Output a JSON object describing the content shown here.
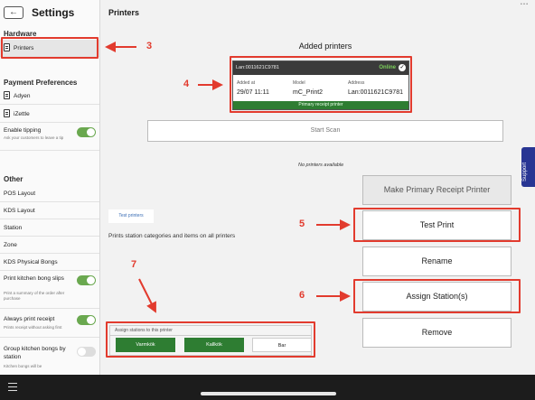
{
  "status_bar": {
    "dots": "• • •"
  },
  "sidebar": {
    "back_label": "←",
    "title": "Settings",
    "hardware": {
      "heading": "Hardware",
      "items": [
        {
          "label": "Printers"
        }
      ]
    },
    "payment": {
      "heading": "Payment Preferences",
      "items": [
        {
          "label": "Adyen"
        },
        {
          "label": "iZettle"
        }
      ],
      "tipping": {
        "label": "Enable tipping",
        "sub": "Ask your customers to leave a tip",
        "enabled": true
      }
    },
    "other": {
      "heading": "Other",
      "items": [
        {
          "label": "POS Layout"
        },
        {
          "label": "KDS Layout"
        },
        {
          "label": "Station"
        },
        {
          "label": "Zone"
        },
        {
          "label": "KDS Physical Bongs"
        }
      ],
      "print_bong": {
        "label": "Print kitchen bong slips",
        "sub": "Print a summary of the order after purchase",
        "enabled": true
      },
      "always_print": {
        "label": "Always print receipt",
        "sub": "Prints receipt without asking first",
        "enabled": true
      },
      "group_bongs": {
        "label": "Group kitchen bongs by station",
        "sub": "Kitchen bongs will be",
        "enabled": false
      }
    }
  },
  "main": {
    "title": "Printers",
    "added_title": "Added printers",
    "printer": {
      "name": "Lan:0011621C9781",
      "status": "Online",
      "added_at_label": "Added at",
      "added_at": "29/07 11:11",
      "model_label": "Model",
      "model": "mC_Print2",
      "address_label": "Address",
      "address": "Lan:0011621C9781",
      "role": "Primary receipt printer"
    },
    "start_scan": "Start Scan",
    "no_printers": "No printers available",
    "buttons": {
      "make_primary": "Make Primary Receipt Printer",
      "test_print": "Test Print",
      "rename": "Rename",
      "assign_stations": "Assign Station(s)",
      "remove": "Remove"
    },
    "test_printers_link": "Test printers",
    "info_text": "Prints station categories and items on all printers",
    "assign_panel": {
      "title": "Assign stations to this printer",
      "stations": [
        {
          "label": "Varmkök",
          "selected": true
        },
        {
          "label": "Kallkök",
          "selected": true
        },
        {
          "label": "Bar",
          "selected": false
        }
      ]
    }
  },
  "annotations": {
    "n3": "3",
    "n4": "4",
    "n5": "5",
    "n6": "6",
    "n7": "7",
    "color": "#e23b2e"
  },
  "support_label": "Support"
}
